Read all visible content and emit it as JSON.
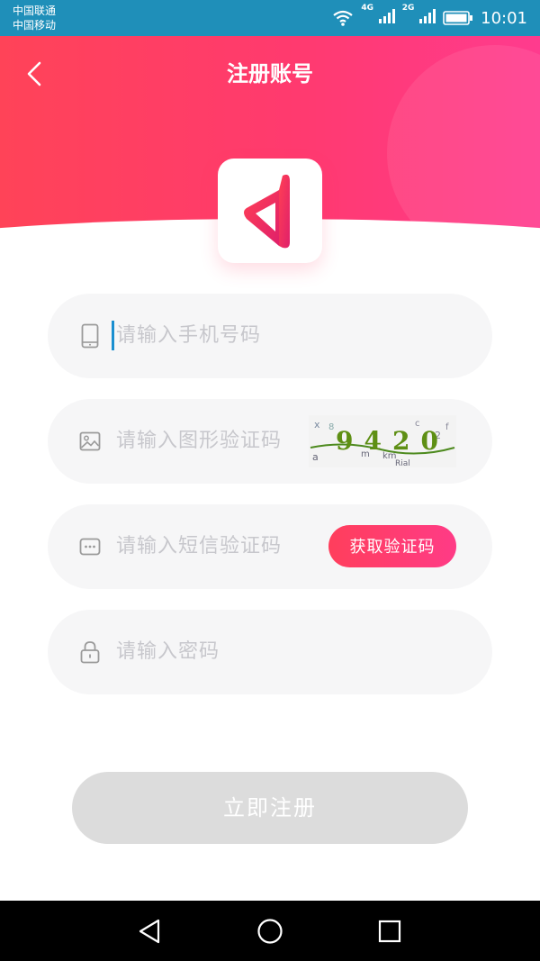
{
  "status_bar": {
    "carrier_1": "中国联通",
    "carrier_2": "中国移动",
    "net_1": "4G",
    "net_2": "2G",
    "time": "10:01",
    "icons": [
      "wifi-icon",
      "signal-icon",
      "signal-icon",
      "battery-icon"
    ]
  },
  "header": {
    "title": "注册账号",
    "back_icon": "chevron-left-icon",
    "gradient_colors": [
      "#ff4358",
      "#ff3b8e"
    ]
  },
  "form": {
    "phone": {
      "placeholder": "请输入手机号码",
      "icon": "phone-icon"
    },
    "captcha": {
      "placeholder": "请输入图形验证码",
      "icon": "image-icon",
      "captcha_text": "9420"
    },
    "sms": {
      "placeholder": "请输入短信验证码",
      "icon": "message-icon",
      "button_label": "获取验证码"
    },
    "password": {
      "placeholder": "请输入密码",
      "icon": "lock-icon"
    }
  },
  "register_button": {
    "label": "立即注册",
    "state": "disabled"
  },
  "nav": {
    "icons": [
      "back-triangle-icon",
      "home-circle-icon",
      "recents-square-icon"
    ]
  },
  "colors": {
    "accent": "#ff3e5c",
    "status_bar": "#1f8fb9",
    "field_bg": "#f6f6f7",
    "placeholder": "#c7c7cc",
    "button_disabled": "#dcdcdc"
  }
}
